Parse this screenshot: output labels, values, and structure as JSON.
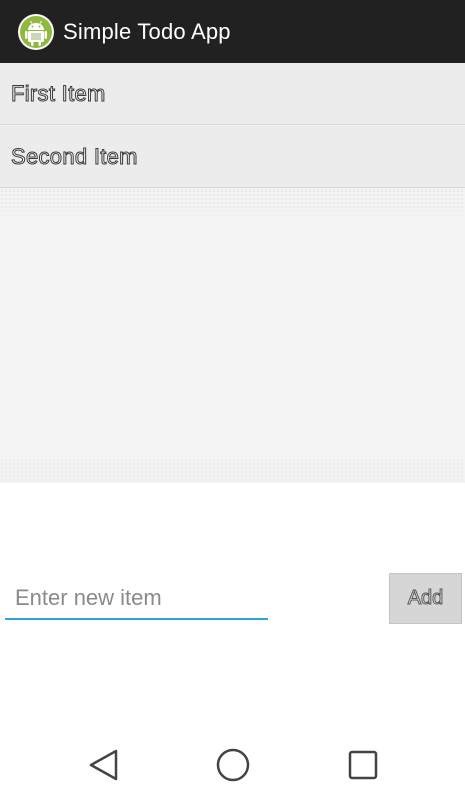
{
  "app": {
    "title": "Simple Todo App",
    "icon": "android-robot-icon"
  },
  "list": {
    "items": [
      {
        "label": "First Item"
      },
      {
        "label": "Second Item"
      }
    ]
  },
  "new_item": {
    "value": "",
    "placeholder": "Enter new item"
  },
  "add_button": {
    "label": "Add"
  },
  "nav": {
    "back_icon": "back-triangle-icon",
    "home_icon": "home-circle-icon",
    "recents_icon": "recents-square-icon"
  },
  "colors": {
    "action_bar": "#212121",
    "input_underline": "#33a3d6",
    "list_background": "#f3f3f3"
  }
}
